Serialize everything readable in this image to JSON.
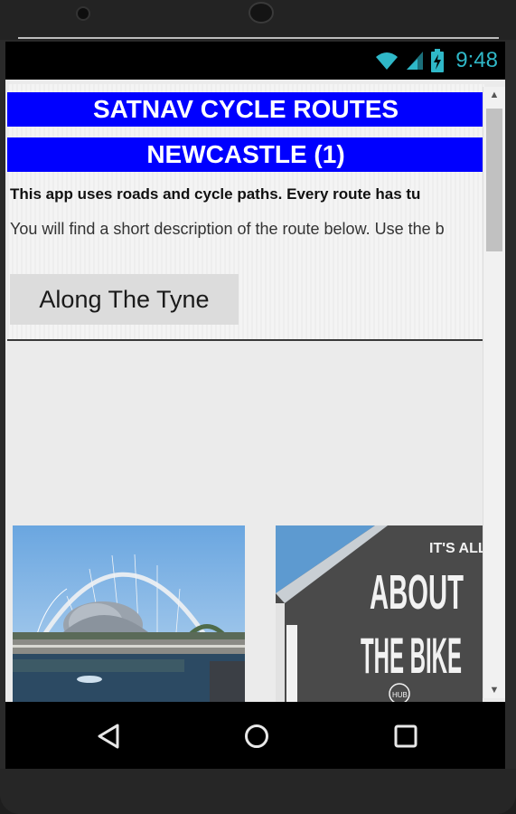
{
  "status_bar": {
    "time": "9:48",
    "accent_color": "#2fb8c8"
  },
  "app": {
    "title_line1": "SATNAV CYCLE ROUTES",
    "title_line2": "NEWCASTLE (1)",
    "intro_bold": "This app uses roads and cycle paths. Every route has tu",
    "intro_text": "You will find a short description of the route below. Use the b",
    "route_button": "Along The Tyne",
    "title_bg_color": "#0000ff"
  },
  "photos": {
    "left": {
      "subject": "millennium-bridge-river-tyne"
    },
    "right": {
      "text_line1": "IT'S ALL",
      "text_line2": "ABOUT",
      "text_line3": "THE BIKE",
      "badge": "HUB"
    }
  },
  "nav": {
    "back": "back-icon",
    "home": "home-icon",
    "recents": "recents-icon"
  }
}
